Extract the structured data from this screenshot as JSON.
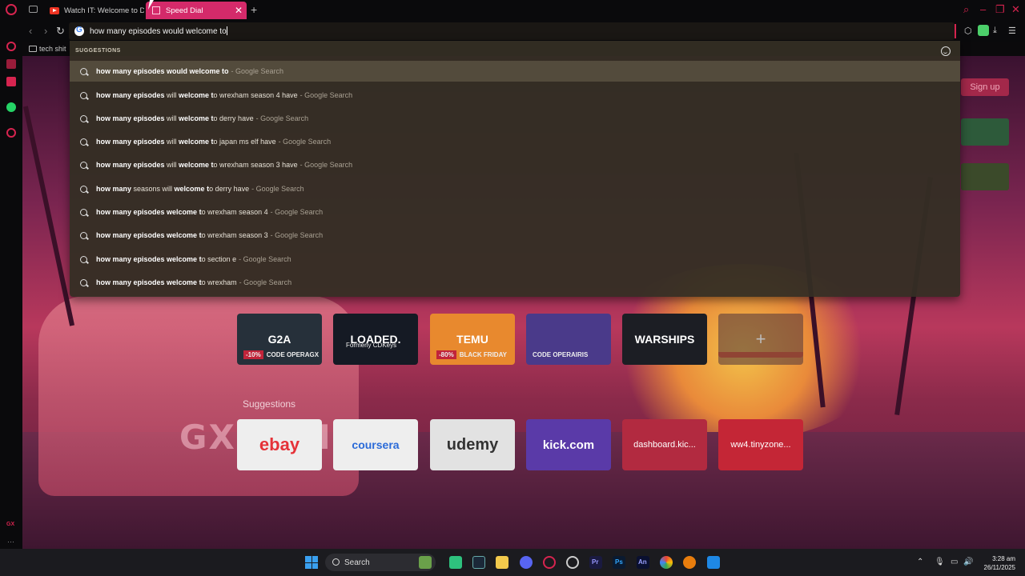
{
  "tabs": [
    {
      "label": "Watch IT: Welcome to De",
      "active": false
    },
    {
      "label": "Speed Dial",
      "active": true
    }
  ],
  "address_bar": {
    "value": "how many episodes would welcome to"
  },
  "bookmarks": [
    {
      "label": "tech shit"
    }
  ],
  "dropdown": {
    "header": "SUGGESTIONS",
    "suggestions": [
      {
        "bold": "how many episodes would welcome to",
        "rest": "",
        "source": "- Google Search"
      },
      {
        "bold": "how many episodes",
        "mid1": " will ",
        "bold2": "welcome t",
        "rest": "o wrexham season 4 have",
        "source": "- Google Search"
      },
      {
        "bold": "how many episodes",
        "mid1": " will ",
        "bold2": "welcome t",
        "rest": "o derry have",
        "source": "- Google Search"
      },
      {
        "bold": "how many episodes",
        "mid1": " will ",
        "bold2": "welcome t",
        "rest": "o japan ms elf have",
        "source": "- Google Search"
      },
      {
        "bold": "how many episodes",
        "mid1": " will ",
        "bold2": "welcome t",
        "rest": "o wrexham season 3 have",
        "source": "- Google Search"
      },
      {
        "bold": "how many",
        "mid1": " seasons will ",
        "bold2": "welcome t",
        "rest": "o derry have",
        "source": "- Google Search"
      },
      {
        "bold": "how many episodes",
        "mid1": " ",
        "bold2": "welcome t",
        "rest": "o wrexham season 4",
        "source": "- Google Search"
      },
      {
        "bold": "how many episodes",
        "mid1": " ",
        "bold2": "welcome t",
        "rest": "o wrexham season 3",
        "source": "- Google Search"
      },
      {
        "bold": "how many episodes",
        "mid1": " ",
        "bold2": "welcome t",
        "rest": "o section e",
        "source": "- Google Search"
      },
      {
        "bold": "how many episodes",
        "mid1": " ",
        "bold2": "welcome t",
        "rest": "o wrexham",
        "source": "- Google Search"
      }
    ]
  },
  "speed_dial": {
    "signup_label": "Sign up",
    "tiles": [
      {
        "title": "G2A",
        "caption_tag": "-10%",
        "caption": "CODE OPERAGX"
      },
      {
        "title": "LOADED.",
        "caption": "Formerly CDKeys"
      },
      {
        "title": "TEMU",
        "caption_tag": "-80%",
        "caption": "BLACK FRIDAY"
      },
      {
        "title": "",
        "caption": "CODE OPERAIRIS"
      },
      {
        "title": "WARSHIPS",
        "caption": ""
      },
      {
        "title": "+",
        "caption": ""
      }
    ],
    "suggestions_label": "Suggestions",
    "suggestion_tiles": [
      {
        "title": "ebay"
      },
      {
        "title": "coursera"
      },
      {
        "title": "udemy"
      },
      {
        "title": "kick.com"
      },
      {
        "title": "dashboard.kic..."
      },
      {
        "title": "ww4.tinyzone..."
      }
    ],
    "background_text": "GX VAN"
  },
  "sidebar": {
    "bottom_label": "GX"
  },
  "taskbar": {
    "search_label": "Search",
    "time": "3:28 am",
    "date": "26/11/2025",
    "pinned": [
      "Pr",
      "Ps",
      "An"
    ]
  },
  "colors": {
    "accent": "#d6244f",
    "active_tab": "#d42a6a",
    "dropdown_bg": "#342e24"
  }
}
